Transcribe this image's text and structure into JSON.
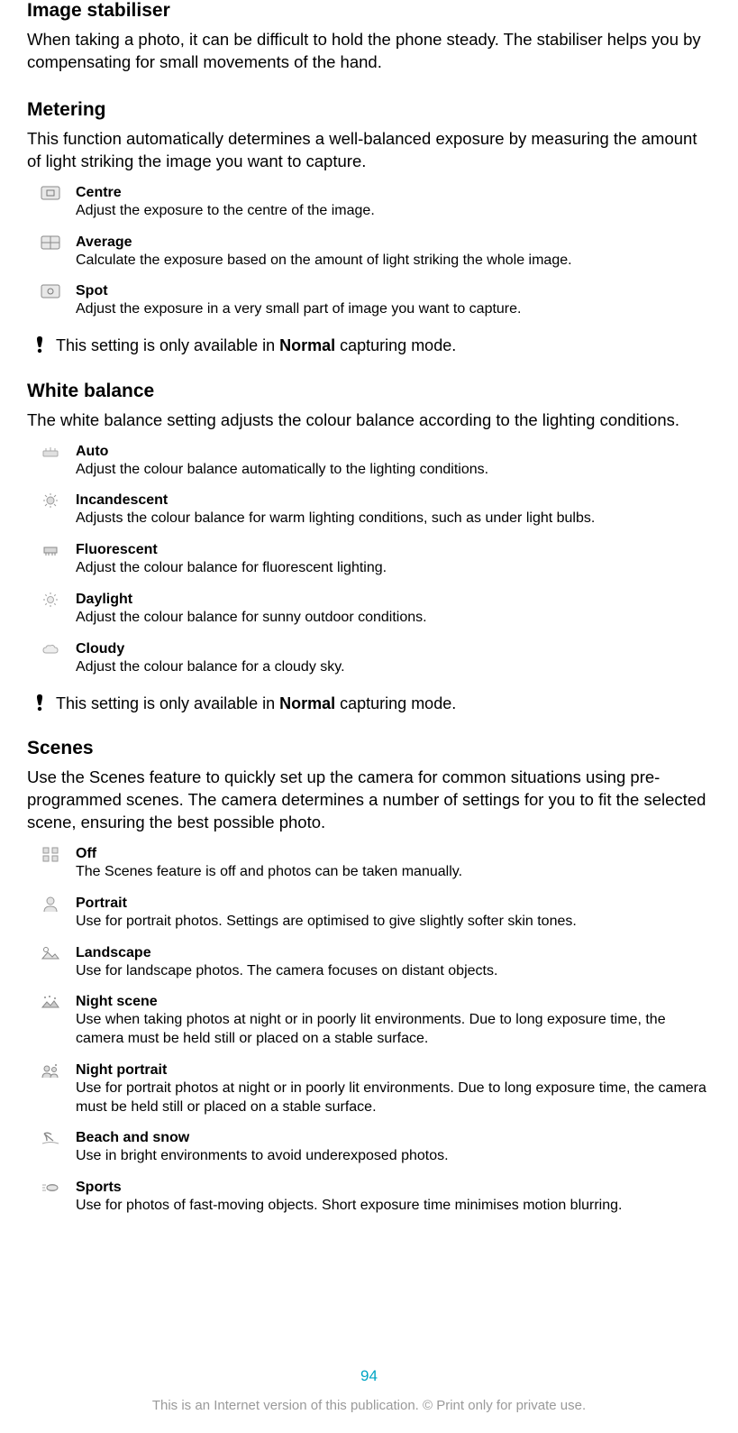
{
  "sections": {
    "imageStabiliser": {
      "heading": "Image stabiliser",
      "intro": "When taking a photo, it can be difficult to hold the phone steady. The stabiliser helps you by compensating for small movements of the hand."
    },
    "metering": {
      "heading": "Metering",
      "intro": "This function automatically determines a well-balanced exposure by measuring the amount of light striking the image you want to capture.",
      "items": [
        {
          "title": "Centre",
          "desc": "Adjust the exposure to the centre of the image."
        },
        {
          "title": "Average",
          "desc": "Calculate the exposure based on the amount of light striking the whole image."
        },
        {
          "title": "Spot",
          "desc": "Adjust the exposure in a very small part of image you want to capture."
        }
      ],
      "note_prefix": "This setting is only available in ",
      "note_bold": "Normal",
      "note_suffix": " capturing mode."
    },
    "whiteBalance": {
      "heading": "White balance",
      "intro": "The white balance setting adjusts the colour balance according to the lighting conditions.",
      "items": [
        {
          "title": "Auto",
          "desc": "Adjust the colour balance automatically to the lighting conditions."
        },
        {
          "title": "Incandescent",
          "desc": "Adjusts the colour balance for warm lighting conditions, such as under light bulbs."
        },
        {
          "title": "Fluorescent",
          "desc": "Adjust the colour balance for fluorescent lighting."
        },
        {
          "title": "Daylight",
          "desc": "Adjust the colour balance for sunny outdoor conditions."
        },
        {
          "title": "Cloudy",
          "desc": "Adjust the colour balance for a cloudy sky."
        }
      ],
      "note_prefix": "This setting is only available in ",
      "note_bold": "Normal",
      "note_suffix": " capturing mode."
    },
    "scenes": {
      "heading": "Scenes",
      "intro": "Use the Scenes feature to quickly set up the camera for common situations using pre-programmed scenes. The camera determines a number of settings for you to fit the selected scene, ensuring the best possible photo.",
      "items": [
        {
          "title": "Off",
          "desc": "The Scenes feature is off and photos can be taken manually."
        },
        {
          "title": "Portrait",
          "desc": "Use for portrait photos. Settings are optimised to give slightly softer skin tones."
        },
        {
          "title": "Landscape",
          "desc": "Use for landscape photos. The camera focuses on distant objects."
        },
        {
          "title": "Night scene",
          "desc": "Use when taking photos at night or in poorly lit environments. Due to long exposure time, the camera must be held still or placed on a stable surface."
        },
        {
          "title": "Night portrait",
          "desc": "Use for portrait photos at night or in poorly lit environments. Due to long exposure time, the camera must be held still or placed on a stable surface."
        },
        {
          "title": "Beach and snow",
          "desc": "Use in bright environments to avoid underexposed photos."
        },
        {
          "title": "Sports",
          "desc": "Use for photos of fast-moving objects. Short exposure time minimises motion blurring."
        }
      ]
    }
  },
  "footer": {
    "page": "94",
    "copyright": "This is an Internet version of this publication. © Print only for private use."
  }
}
